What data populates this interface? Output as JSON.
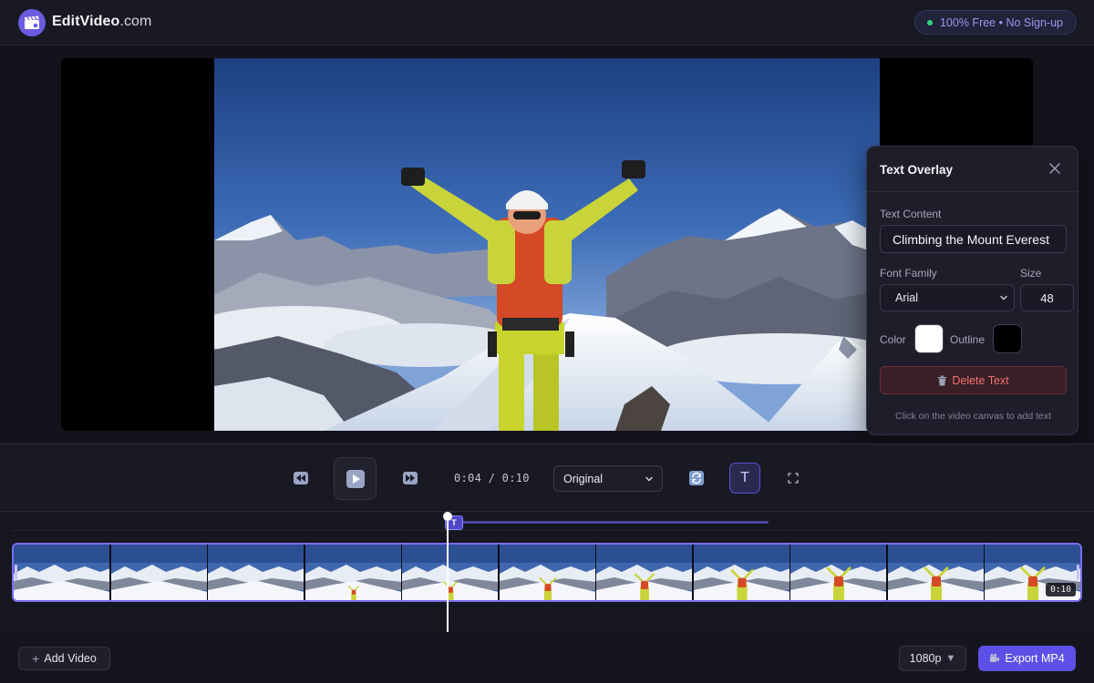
{
  "header": {
    "brand": "EditVideo",
    "brand_domain": ".com",
    "badge": "100% Free • No Sign-up",
    "accent": "#6b5be0"
  },
  "player": {
    "image": "climber with raised arms on snowy mountain summit"
  },
  "text_overlay_panel": {
    "title": "Text Overlay",
    "text_content_label": "Text Content",
    "text_content_value": "Climbing the Mount Everest",
    "font_family_label": "Font Family",
    "font_family_value": "Arial",
    "size_label": "Size",
    "size_value": "48",
    "color_label": "Color",
    "color_value": "#ffffff",
    "outline_label": "Outline",
    "outline_value": "#000000",
    "delete_label": "Delete Text",
    "hint": "Click on the video canvas to add text"
  },
  "controls": {
    "current_time": "0:04",
    "duration": "0:10",
    "time_display": "0:04 / 0:10",
    "aspect_ratio": "Original",
    "text_tool_label": "T",
    "icons": [
      "rewind-icon",
      "play-icon",
      "forward-icon",
      "refresh-icon",
      "text-icon",
      "fullscreen-icon"
    ]
  },
  "timeline": {
    "overlay_marker_label": "T",
    "clip_duration": "0:10",
    "frame_count": 11,
    "playhead_fraction": 0.4
  },
  "footer": {
    "add_video_label": "Add Video",
    "resolution_label": "1080p",
    "export_label": "Export MP4",
    "export_color": "#5d50e6"
  }
}
